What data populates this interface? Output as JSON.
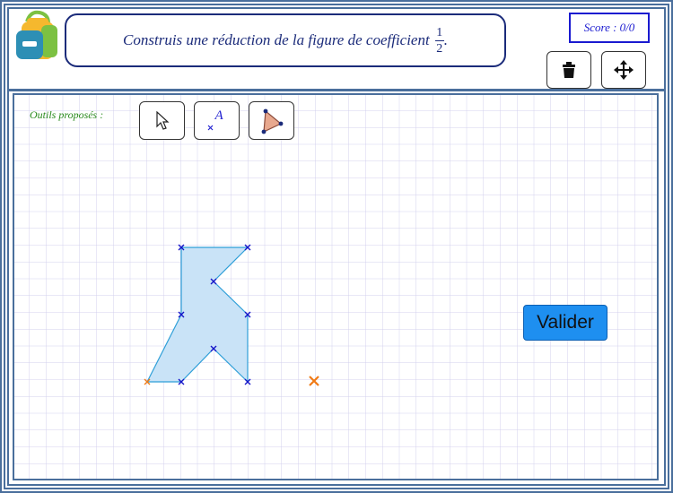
{
  "instruction": {
    "text": "Construis une réduction de la figure de coefficient",
    "fraction_numerator": "1",
    "fraction_denominator": "2",
    "end_punct": "."
  },
  "score": {
    "text": "Score : 0/0"
  },
  "toolbar": {
    "label": "Outils proposés :",
    "tool_point_letter": "A"
  },
  "valider_label": "Valider",
  "icons": [
    "schoolbag-icon",
    "trash-icon",
    "move-arrows-icon",
    "pointer-arrow-icon",
    "point-tool-icon",
    "polygon-tool-icon"
  ],
  "colors": {
    "border": "#4a6f9c",
    "figure_fill": "#c9e3f7",
    "figure_stroke": "#2f9fd8",
    "vertex": "#1414c8",
    "anchor": "#f07a14",
    "grid": "#d3d0ee",
    "valider": "#1e8ff0"
  }
}
